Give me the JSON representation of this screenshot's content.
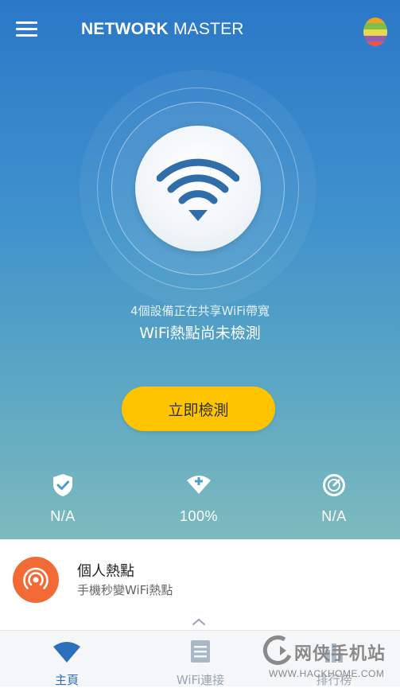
{
  "header": {
    "title_bold": "NETWORK",
    "title_light": "MASTER",
    "menu_icon": "hamburger-icon",
    "egg_icon": "easter-egg-icon"
  },
  "scan": {
    "devices_text": "4個設備正在共享WiFi帶寬",
    "status_text": "WiFi熱點尚未檢測",
    "button_label": "立即檢測",
    "wifi_icon": "wifi-icon"
  },
  "stats": [
    {
      "icon": "shield-check-icon",
      "value": "N/A"
    },
    {
      "icon": "wifi-plus-icon",
      "value": "100%"
    },
    {
      "icon": "speedometer-icon",
      "value": "N/A"
    }
  ],
  "hotspot": {
    "title": "個人熱點",
    "subtitle": "手機秒變WiFi熱點",
    "icon": "hotspot-icon"
  },
  "bottom_nav": [
    {
      "label": "主頁",
      "icon": "wifi-icon",
      "active": true
    },
    {
      "label": "WiFi連接",
      "icon": "list-icon",
      "active": false
    },
    {
      "label": "排行榜",
      "icon": "ranking-icon",
      "active": false
    }
  ],
  "watermark": {
    "cn": "网侠手机站",
    "url": "WWW.HACKHOME.COM"
  },
  "colors": {
    "accent_yellow": "#ffc400",
    "hotspot_orange": "#f26a36",
    "nav_active": "#2b6fbd",
    "hero_top": "#2b78c8",
    "hero_bottom": "#7dbabd"
  }
}
